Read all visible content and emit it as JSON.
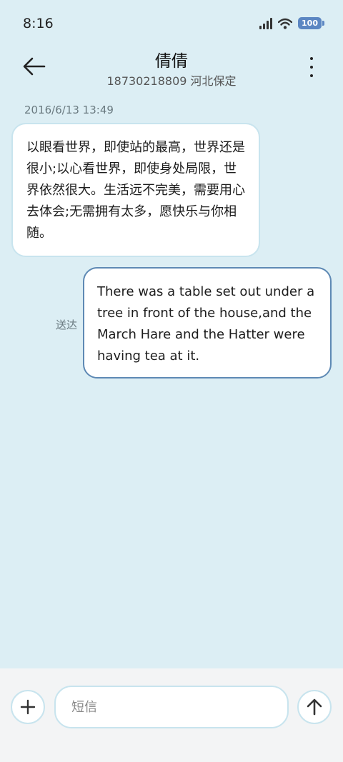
{
  "status_bar": {
    "time": "8:16",
    "battery": "100",
    "icons": [
      "signal-icon",
      "wifi-icon",
      "battery-icon"
    ]
  },
  "header": {
    "contact_name": "倩倩",
    "contact_detail": "18730218809 河北保定",
    "back_icon": "arrow-left-icon",
    "menu_icon": "more-vertical-icon"
  },
  "conversation": {
    "timestamp": "2016/6/13 13:49",
    "messages": [
      {
        "direction": "incoming",
        "text": "以眼看世界，即使站的最高，世界还是很小;以心看世界，即使身处局限，世界依然很大。生活远不完美，需要用心去体会;无需拥有太多，愿快乐与你相随。"
      },
      {
        "direction": "outgoing",
        "text": "There was a table set out under a tree in front of the house,and the March Hare and the Hatter were having tea at it.",
        "status": "送达"
      }
    ]
  },
  "composer": {
    "placeholder": "短信",
    "value": "",
    "add_icon": "plus-icon",
    "send_icon": "arrow-up-icon"
  },
  "colors": {
    "background": "#dceef4",
    "outgoing_border": "#5e89b4",
    "incoming_border": "#c8e4ee",
    "battery": "#5b86c2"
  }
}
